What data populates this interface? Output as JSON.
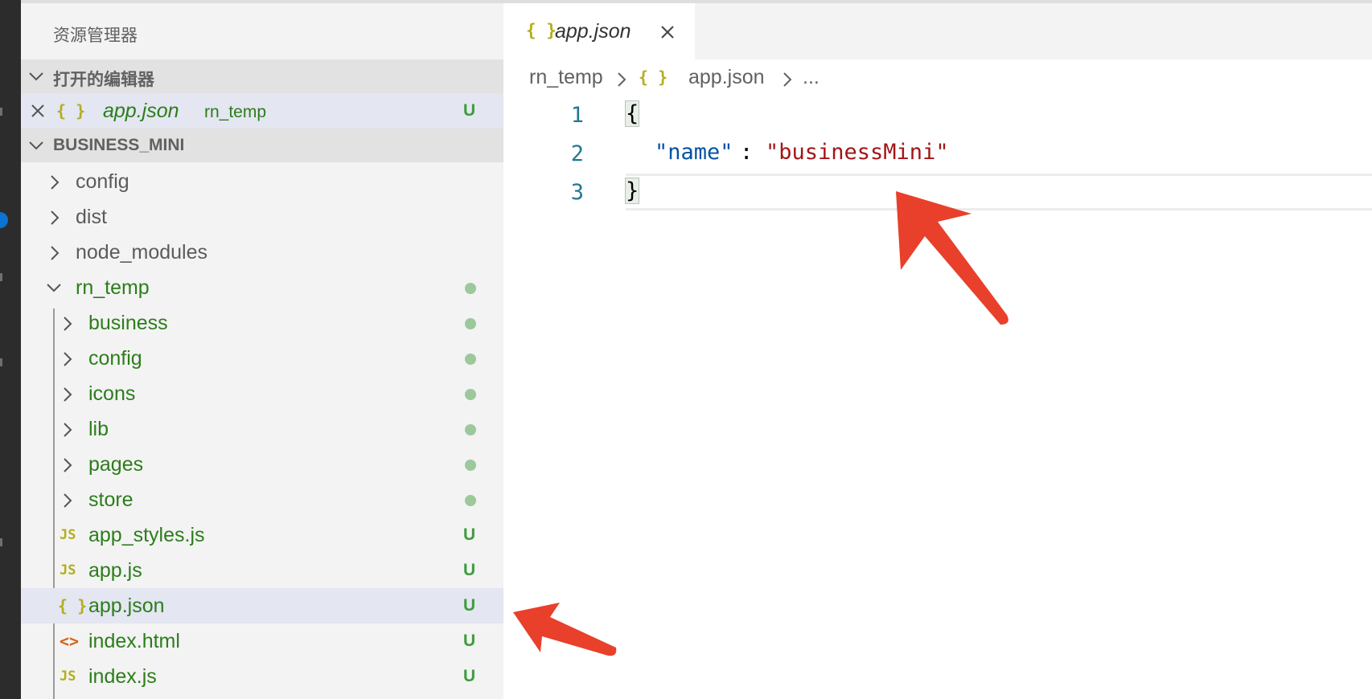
{
  "explorer": {
    "title": "资源管理器",
    "open_editors": {
      "header": "打开的编辑器",
      "items": [
        {
          "name": "app.json",
          "folder": "rn_temp",
          "git": "U",
          "icon": "json-icon"
        }
      ]
    },
    "project": {
      "header": "BUSINESS_MINI",
      "items": [
        {
          "name": "config",
          "type": "folder"
        },
        {
          "name": "dist",
          "type": "folder"
        },
        {
          "name": "node_modules",
          "type": "folder"
        },
        {
          "name": "rn_temp",
          "type": "folder-open",
          "git": "dot"
        },
        {
          "name": "business",
          "type": "folder",
          "git": "dot"
        },
        {
          "name": "config",
          "type": "folder",
          "git": "dot"
        },
        {
          "name": "icons",
          "type": "folder",
          "git": "dot"
        },
        {
          "name": "lib",
          "type": "folder",
          "git": "dot"
        },
        {
          "name": "pages",
          "type": "folder",
          "git": "dot"
        },
        {
          "name": "store",
          "type": "folder",
          "git": "dot"
        },
        {
          "name": "app_styles.js",
          "type": "js",
          "icon_text": "JS",
          "git": "U"
        },
        {
          "name": "app.js",
          "type": "js",
          "icon_text": "JS",
          "git": "U"
        },
        {
          "name": "app.json",
          "type": "json",
          "icon_text": "{ }",
          "git": "U",
          "selected": true
        },
        {
          "name": "index.html",
          "type": "html",
          "icon_text": "<>",
          "git": "U"
        },
        {
          "name": "index.js",
          "type": "js",
          "icon_text": "JS",
          "git": "U"
        }
      ]
    }
  },
  "editor": {
    "tab": {
      "label": "app.json",
      "icon_text": "{ }"
    },
    "breadcrumb": {
      "folder": "rn_temp",
      "file_icon": "{ }",
      "file": "app.json",
      "more": "..."
    },
    "lines": {
      "n1": "1",
      "n2": "2",
      "n3": "3",
      "open_brace": "{",
      "key": "\"name\"",
      "colon": ": ",
      "value": "\"businessMini\"",
      "close_brace": "}"
    }
  },
  "colors": {
    "accent_annotation": "#e8402b",
    "git_untracked": "#3e9c3e",
    "json_icon": "#b4ad1f",
    "js_icon": "#b4ad1f",
    "html_icon": "#d0661d"
  }
}
